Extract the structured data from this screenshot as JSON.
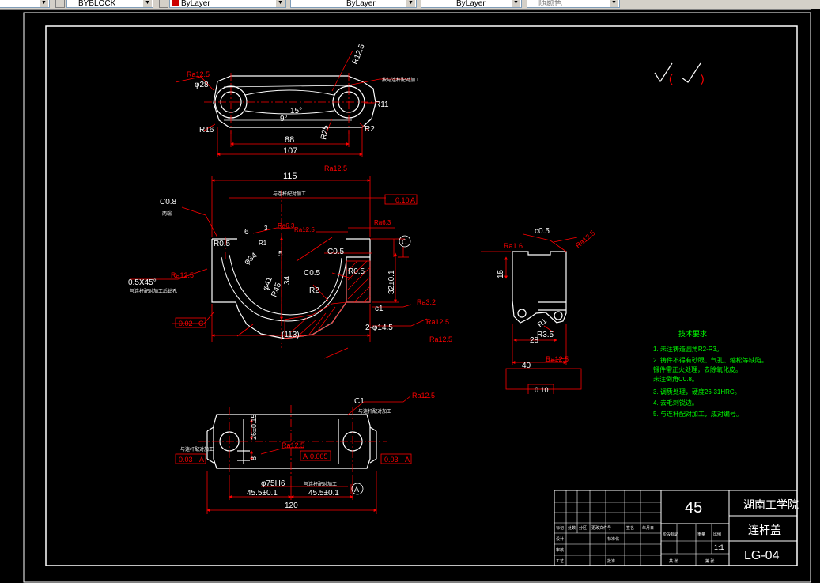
{
  "toolbar": {
    "layer_combo": "",
    "text_style": "BYBLOCK",
    "color_combo": "ByLayer",
    "linetype_combo": "ByLayer",
    "lineweight_combo": "ByLayer",
    "plotstyle_combo": "随颜色"
  },
  "colors": {
    "drawing_line": "#ffffff",
    "dimension": "#ff0000",
    "notes_green": "#00ff00",
    "background": "#000000"
  },
  "views": {
    "top": {
      "dims": [
        "Ra12.5",
        "φ28",
        "R12.5",
        "R11",
        "15°",
        "9°",
        "R16",
        "R25",
        "R2",
        "88",
        "107"
      ],
      "note": "按与连杆配对加工"
    },
    "front": {
      "dims": [
        "115",
        "Ra12.5",
        "C0.8",
        "R0.5",
        "6",
        "R1",
        "3",
        "5",
        "φ34",
        "34",
        "R45",
        "φ41",
        "C0.5",
        "C0.5",
        "R0.5",
        "R2",
        "32±0.1",
        "c1",
        "Ra3.2",
        "Ra12.5",
        "Ra12.5",
        "2-φ14.5",
        "(113)",
        "0.5X45°",
        "Ra12.5",
        "0.02",
        "C",
        "Ra6.3",
        "Ra6.3",
        "Ra12.5",
        "0.10",
        "A",
        "C"
      ],
      "notes": [
        "两端",
        "与连杆配对加工",
        "与连杆配对加工后钻孔"
      ]
    },
    "side": {
      "dims": [
        "c0.5",
        "Ra12.5",
        "Ra1.6",
        "15",
        "R1",
        "R3.5",
        "28",
        "40",
        "Ra12.5",
        "0.10"
      ]
    },
    "bottom": {
      "dims": [
        "C1",
        "Ra12.5",
        "26±0.15",
        "8",
        "Ra12.5",
        "0.005",
        "A",
        "0.03",
        "A",
        "0.03",
        "A",
        "φ75H6",
        "45.5±0.1",
        "45.5±0.1",
        "120",
        "A"
      ],
      "notes": [
        "与连杆配对加工",
        "与连杆配对加工",
        "与连杆配对加工"
      ]
    }
  },
  "roughness_symbol": "√(√)",
  "tech_requirements": {
    "title": "技术要求",
    "items": [
      "1. 未注铸造圆角R2-R3。",
      "2. 铸件不得有砂眼、气孔、缩松等缺陷。",
      "   锻件需正火处理，去除氧化皮。",
      "   未注倒角C0.8。",
      "3. 调质处理，硬度26-31HRC。",
      "4. 去毛刺锐边。",
      "5. 与连杆配对加工，成对编号。"
    ]
  },
  "title_block": {
    "material": "45",
    "school": "湖南工学院",
    "part_name": "连杆盖",
    "drawing_no": "LG-04",
    "scale": "1:1",
    "small_cells": [
      "标记",
      "处数",
      "分区",
      "更改文件号",
      "签名",
      "年月日",
      "设计",
      "标准化",
      "阶段标记",
      "重量",
      "比例",
      "审核",
      "工艺",
      "批准",
      "共 张",
      "第 张"
    ]
  }
}
